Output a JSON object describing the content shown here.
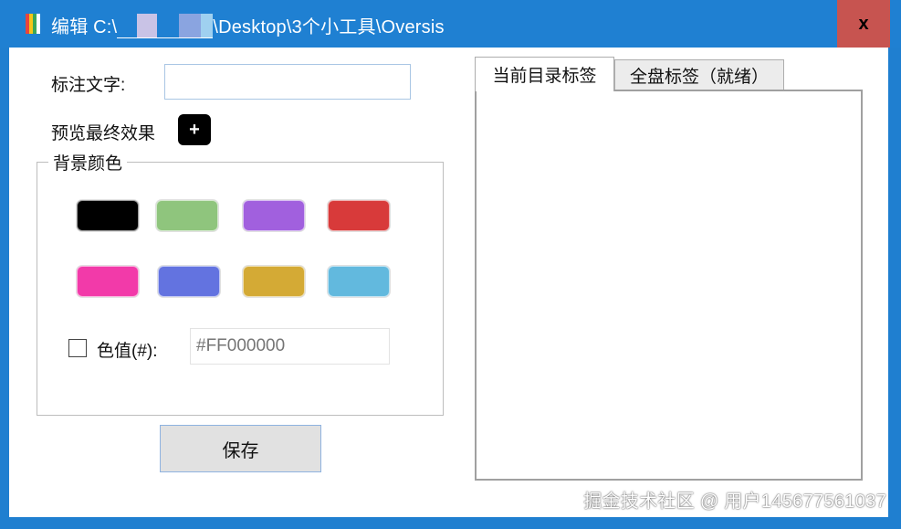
{
  "window": {
    "title_prefix": "编辑 C:\\",
    "title_suffix": "\\Desktop\\3个小工具\\Oversis",
    "close_label": "x",
    "titlebar_color": "#1f80d2"
  },
  "form": {
    "annotation_label": "标注文字:",
    "annotation_value": "",
    "preview_label": "预览最终效果",
    "preview_button": "+"
  },
  "background_color": {
    "group_title": "背景颜色",
    "swatches": [
      {
        "name": "black",
        "color": "#000000"
      },
      {
        "name": "green",
        "color": "#8fc57d"
      },
      {
        "name": "purple",
        "color": "#a160de"
      },
      {
        "name": "red",
        "color": "#d83a3a"
      },
      {
        "name": "pink",
        "color": "#f23aa9"
      },
      {
        "name": "blue",
        "color": "#6373e0"
      },
      {
        "name": "gold",
        "color": "#d4aa35"
      },
      {
        "name": "sky",
        "color": "#62b9de"
      }
    ],
    "custom_label": "色值(#):",
    "custom_placeholder": "#FF000000",
    "custom_checked": false
  },
  "actions": {
    "save_label": "保存"
  },
  "tabs": [
    {
      "label": "当前目录标签",
      "active": true
    },
    {
      "label": "全盘标签（就绪）",
      "active": false
    }
  ],
  "watermark": "掘金技术社区 @ 用户1456775610​37"
}
